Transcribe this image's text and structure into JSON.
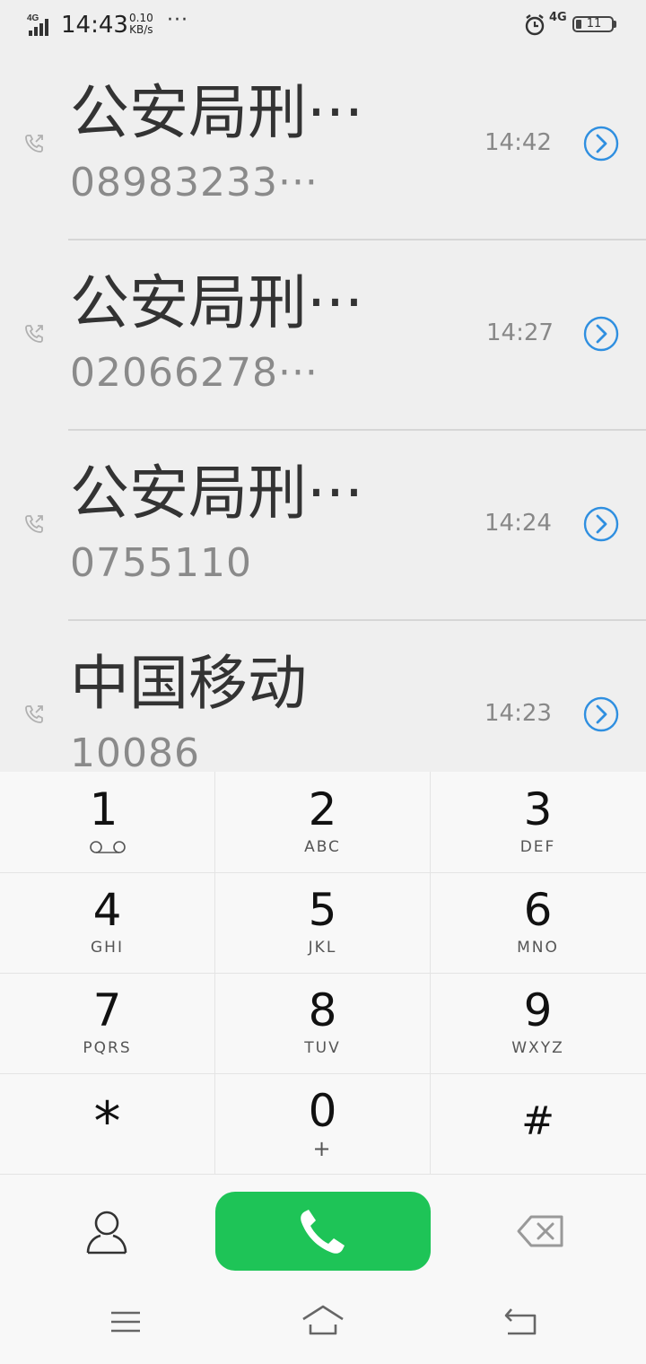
{
  "status_bar": {
    "network_left": "4G",
    "time": "14:43",
    "speed_value": "0.10",
    "speed_unit": "KB/s",
    "more": "···",
    "network_right": "4G",
    "battery": "11"
  },
  "call_log": [
    {
      "name": "公安局刑···",
      "number": "08983233···",
      "time": "14:42"
    },
    {
      "name": "公安局刑···",
      "number": "02066278···",
      "time": "14:27"
    },
    {
      "name": "公安局刑···",
      "number": "0755110",
      "time": "14:24"
    },
    {
      "name": "中国移动",
      "number": "10086",
      "time": "14:23"
    }
  ],
  "dialpad": {
    "keys": [
      {
        "digit": "1",
        "letters": ""
      },
      {
        "digit": "2",
        "letters": "ABC"
      },
      {
        "digit": "3",
        "letters": "DEF"
      },
      {
        "digit": "4",
        "letters": "GHI"
      },
      {
        "digit": "5",
        "letters": "JKL"
      },
      {
        "digit": "6",
        "letters": "MNO"
      },
      {
        "digit": "7",
        "letters": "PQRS"
      },
      {
        "digit": "8",
        "letters": "TUV"
      },
      {
        "digit": "9",
        "letters": "WXYZ"
      },
      {
        "digit": "*",
        "letters": ""
      },
      {
        "digit": "0",
        "letters": "+"
      },
      {
        "digit": "#",
        "letters": ""
      }
    ]
  },
  "icons": {
    "voicemail": "voicemail-icon",
    "contacts": "contacts-icon",
    "call": "phone-icon",
    "delete": "backspace-icon",
    "menu": "menu-icon",
    "home": "home-icon",
    "back": "back-icon"
  },
  "colors": {
    "call_button": "#1ec457",
    "detail_icon": "#2f8fe0"
  }
}
